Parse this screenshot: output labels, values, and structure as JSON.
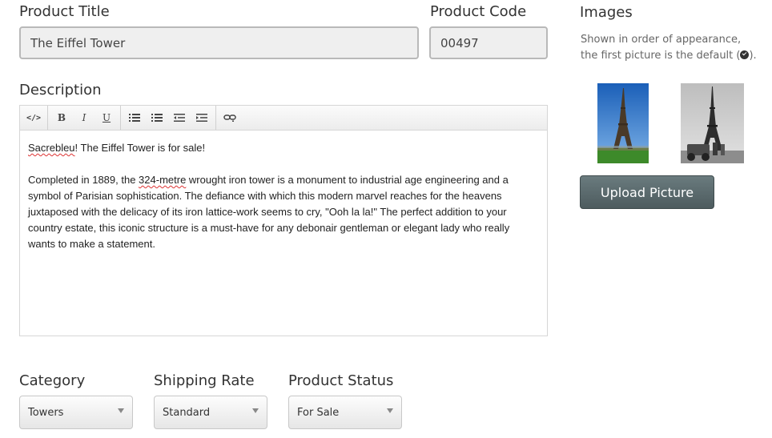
{
  "product_title": {
    "label": "Product Title",
    "value": "The Eiffel Tower"
  },
  "product_code": {
    "label": "Product Code",
    "value": "00497"
  },
  "images": {
    "label": "Images",
    "help_line1": "Shown in order of appearance,",
    "help_line2_prefix": "the first picture is the default (",
    "help_line2_suffix": ").",
    "default_icon": "check-circle-icon",
    "upload_label": "Upload Picture"
  },
  "description": {
    "label": "Description",
    "toolbar": {
      "source_label": "</>",
      "bold_label": "B",
      "italic_label": "I",
      "underline_label": "U"
    },
    "para1_misspelled": "Sacrebleu",
    "para1_rest": "! The Eiffel Tower is for sale!",
    "para2_start": "Completed in 1889, the ",
    "para2_misspelled": "324-metre",
    "para2_rest": " wrought iron tower is a monument to industrial age engineering and a symbol of Parisian sophistication. The defiance with which this modern marvel reaches for the heavens juxtaposed with the delicacy of its iron lattice-work seems to cry, \"Ooh la la!\" The perfect addition to your country estate, this iconic structure is a must-have for any debonair gentleman or elegant lady who really wants to make a statement."
  },
  "category": {
    "label": "Category",
    "selected": "Towers"
  },
  "shipping_rate": {
    "label": "Shipping Rate",
    "selected": "Standard"
  },
  "product_status": {
    "label": "Product Status",
    "selected": "For Sale"
  },
  "colors": {
    "button": "#56666a",
    "sky": "#1f6fc9",
    "grass": "#3d8a2a"
  }
}
